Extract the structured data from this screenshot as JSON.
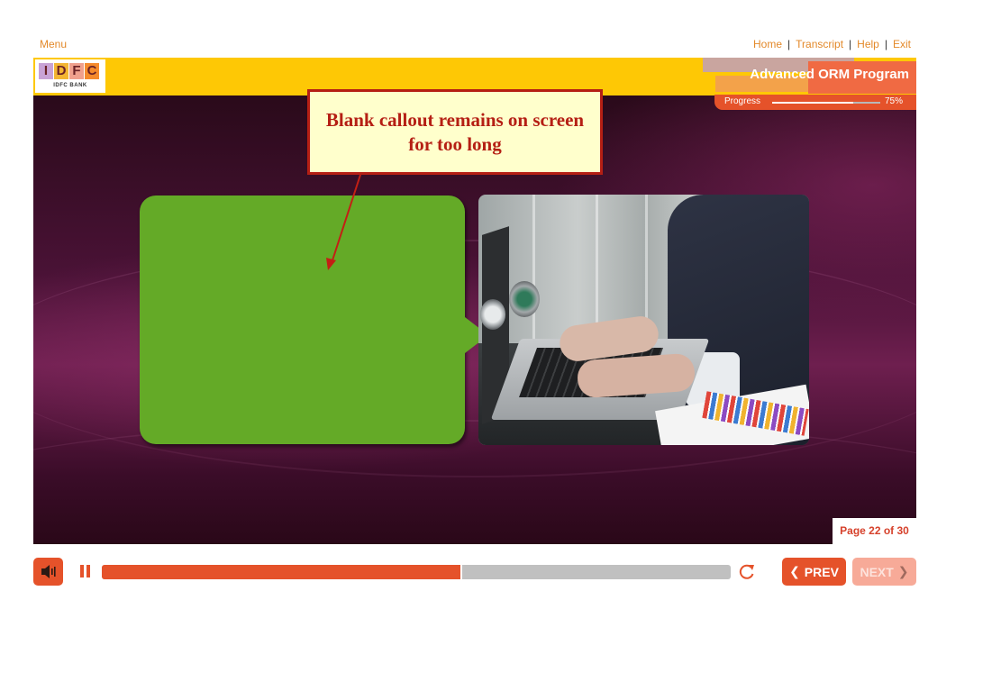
{
  "nav": {
    "menu_label": "Menu",
    "links": [
      "Home",
      "Transcript",
      "Help",
      "Exit"
    ]
  },
  "header": {
    "logo_letters": [
      "I",
      "D",
      "F",
      "C"
    ],
    "logo_letter_colors": [
      "#c9a3d6",
      "#f3b532",
      "#f0a08d",
      "#f58a2c"
    ],
    "logo_subtext": "IDFC BANK",
    "course_title": "Advanced ORM Program",
    "progress_label": "Progress",
    "progress_percent_text": "75%",
    "progress_fraction": 0.75
  },
  "annotation": {
    "text": "Blank callout remains on screen for too long",
    "color": "#b51f14",
    "background": "#ffffcc"
  },
  "page": {
    "indicator": "Page 22 of 30"
  },
  "player": {
    "seek_fraction": 0.57,
    "prev_label": "PREV",
    "next_label": "NEXT",
    "accent": "#e5522a",
    "next_disabled": true
  },
  "icons": {
    "volume": "speaker-icon",
    "pause": "pause-icon",
    "replay": "replay-icon",
    "prev": "chevron-left-icon",
    "next": "chevron-right-icon"
  }
}
